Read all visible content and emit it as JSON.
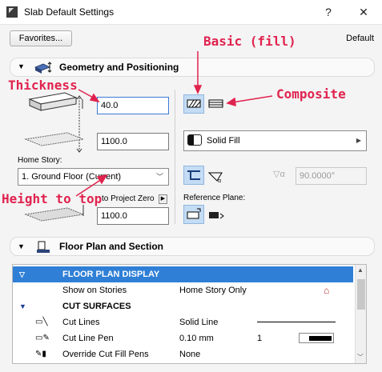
{
  "window": {
    "title": "Slab Default Settings",
    "help": "?",
    "close": "✕"
  },
  "toolbar": {
    "favorites_label": "Favorites...",
    "default_label": "Default"
  },
  "geometry": {
    "header": "Geometry and Positioning",
    "thickness_value": "40.0",
    "offset_value": "1100.0",
    "home_story_label": "Home Story:",
    "home_story_value": "1. Ground Floor (Current)",
    "ref_level_label": "to Project Zero",
    "ref_level_value": "1100.0",
    "fill_value": "Solid Fill",
    "angle_value": "90.0000°",
    "ref_plane_label": "Reference Plane:"
  },
  "annotations": {
    "basic": "Basic (fill)",
    "composite": "Composite",
    "thickness": "Thickness",
    "height_to_top": "Height to top"
  },
  "floor_plan": {
    "header": "Floor Plan and Section",
    "rows": [
      {
        "name": "FLOOR PLAN DISPLAY",
        "value": "",
        "extra": ""
      },
      {
        "name": "Show on Stories",
        "value": "Home Story Only",
        "extra": ""
      },
      {
        "name": "CUT SURFACES",
        "value": "",
        "extra": ""
      },
      {
        "name": "Cut Lines",
        "value": "Solid Line",
        "extra": ""
      },
      {
        "name": "Cut Line Pen",
        "value": "0.10 mm",
        "extra": "1"
      },
      {
        "name": "Override Cut Fill Pens",
        "value": "None",
        "extra": ""
      }
    ]
  },
  "colors": {
    "annotation": "#e0234e",
    "selection": "#2f7fd6"
  }
}
